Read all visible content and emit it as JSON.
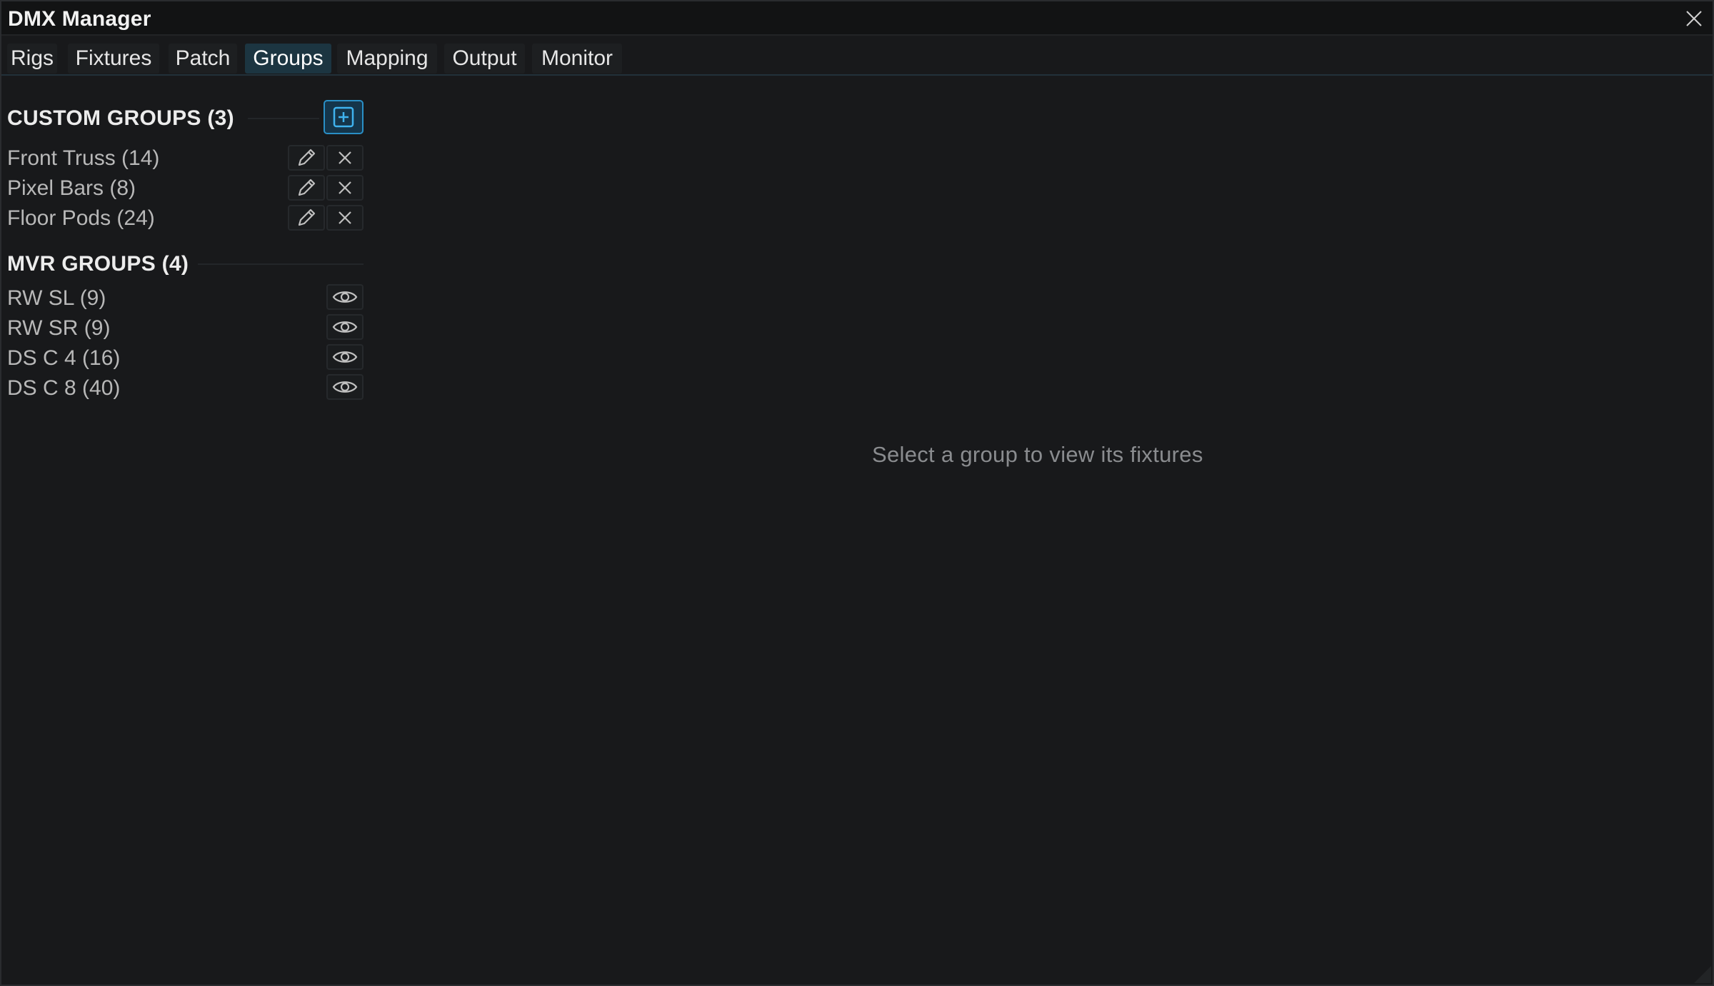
{
  "window": {
    "title": "DMX Manager",
    "close_icon": "close-icon"
  },
  "tabs": [
    {
      "label": "Rigs",
      "active": false
    },
    {
      "label": "Fixtures",
      "active": false
    },
    {
      "label": "Patch",
      "active": false
    },
    {
      "label": "Groups",
      "active": true
    },
    {
      "label": "Mapping",
      "active": false
    },
    {
      "label": "Output",
      "active": false
    },
    {
      "label": "Monitor",
      "active": false
    }
  ],
  "custom_groups": {
    "header": "CUSTOM GROUPS (3)",
    "add_icon": "plus-square-icon",
    "items": [
      {
        "label": "Front Truss (14)",
        "edit_icon": "pencil-icon",
        "delete_icon": "close-icon"
      },
      {
        "label": "Pixel Bars (8)",
        "edit_icon": "pencil-icon",
        "delete_icon": "close-icon"
      },
      {
        "label": "Floor Pods (24)",
        "edit_icon": "pencil-icon",
        "delete_icon": "close-icon"
      }
    ]
  },
  "mvr_groups": {
    "header": "MVR GROUPS (4)",
    "items": [
      {
        "label": "RW SL (9)",
        "view_icon": "eye-icon"
      },
      {
        "label": "RW SR (9)",
        "view_icon": "eye-icon"
      },
      {
        "label": "DS C 4 (16)",
        "view_icon": "eye-icon"
      },
      {
        "label": "DS C 8 (40)",
        "view_icon": "eye-icon"
      }
    ]
  },
  "detail": {
    "placeholder": "Select a group to view its fixtures"
  },
  "colors": {
    "accent": "#2a8fc6",
    "active_tab": "#1c3541",
    "background": "#18191b"
  }
}
